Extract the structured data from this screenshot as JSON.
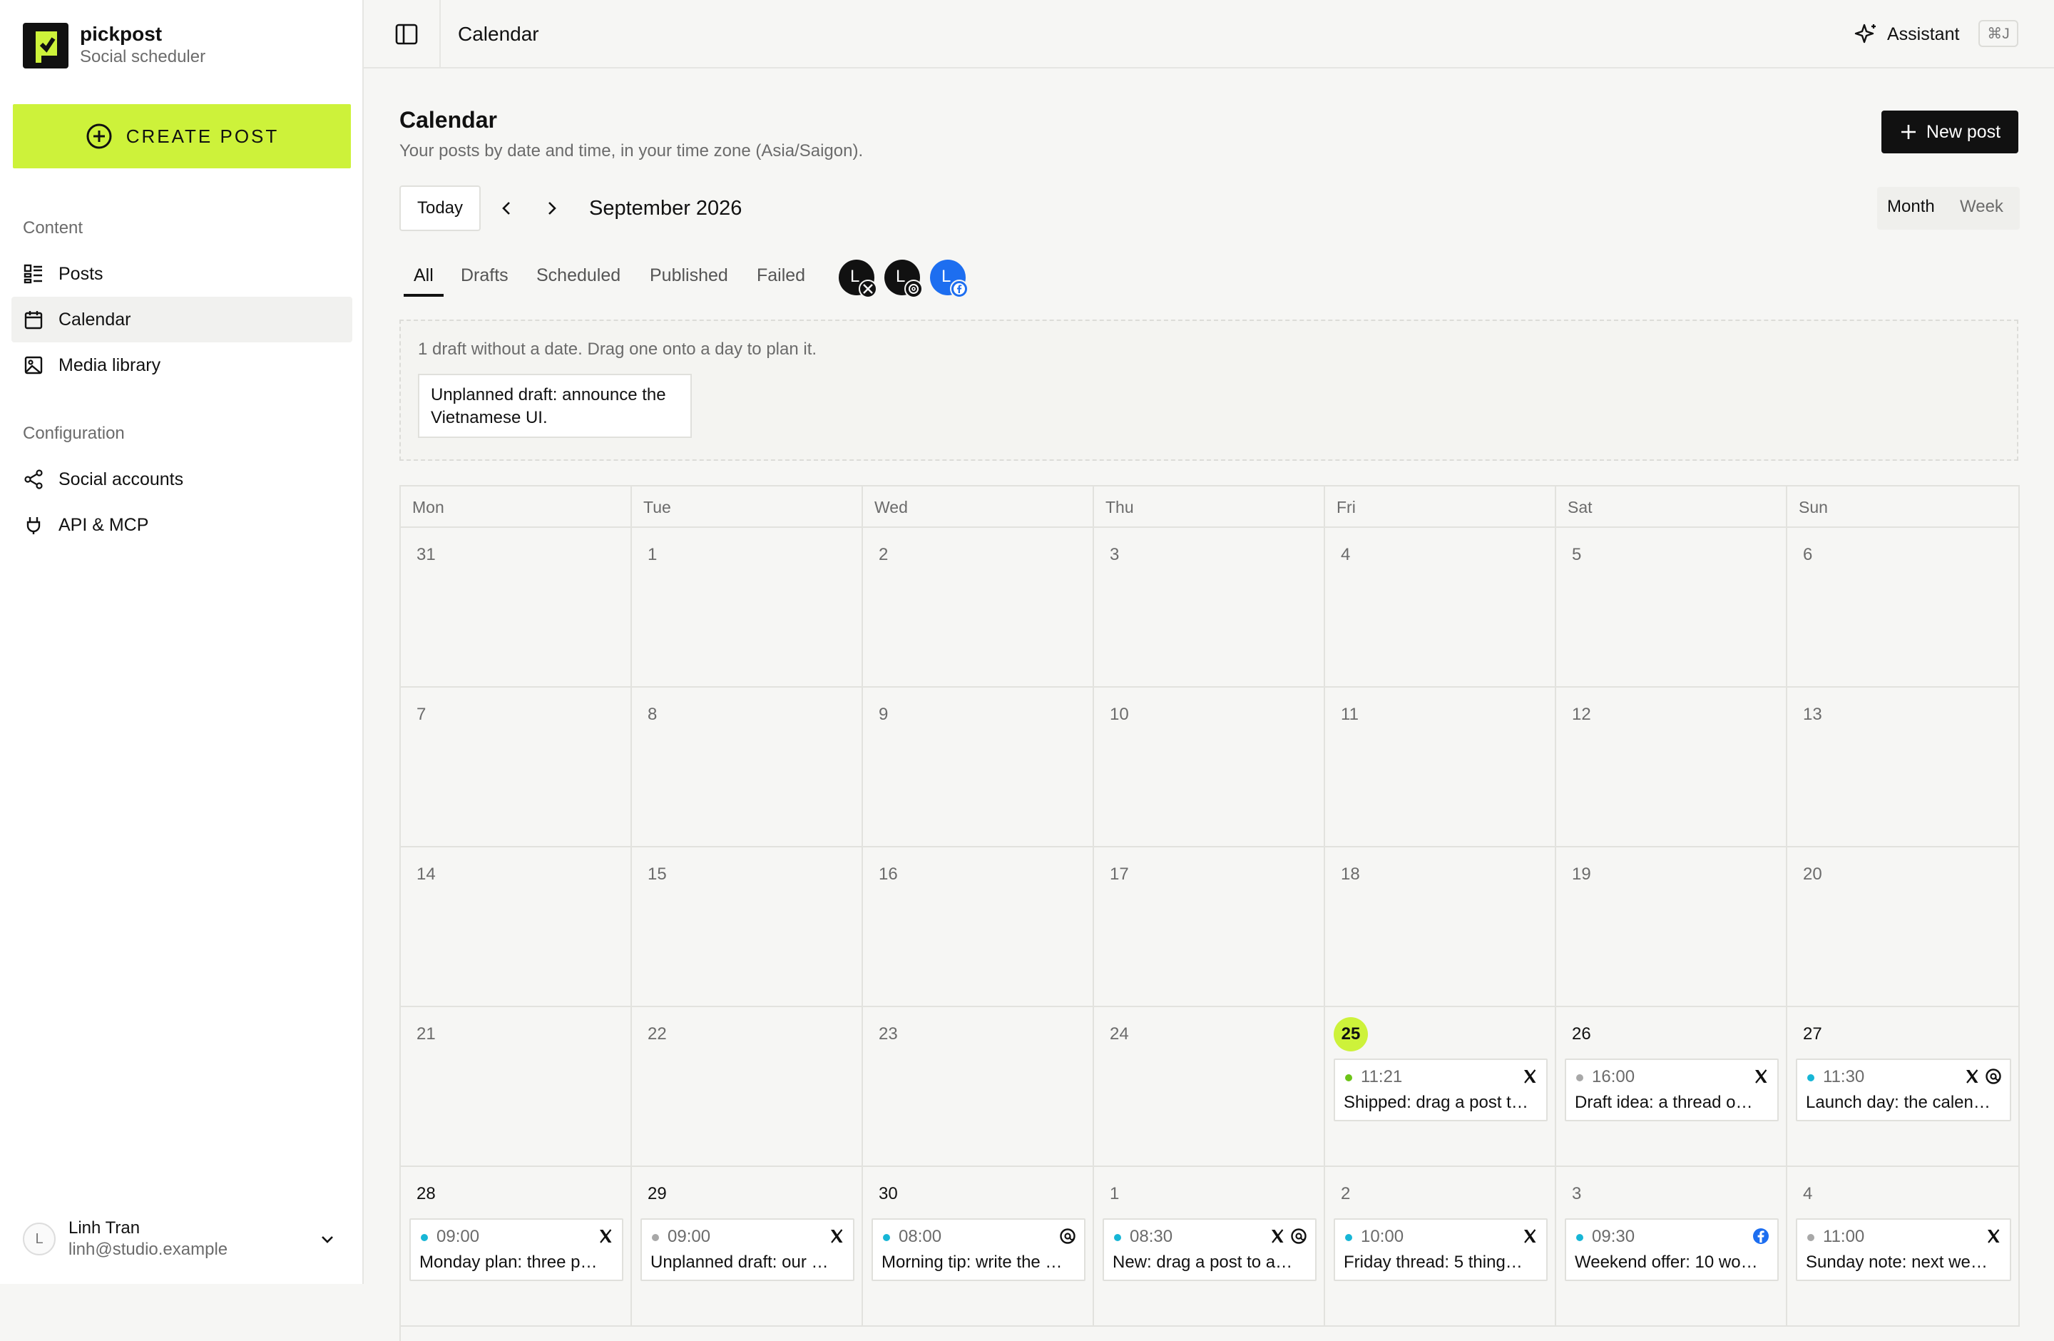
{
  "sidebar": {
    "brand": {
      "name": "pickpost",
      "subtitle": "Social scheduler"
    },
    "create_label": "CREATE POST",
    "sections": [
      {
        "label": "Content",
        "items": [
          {
            "label": "Posts",
            "icon": "posts-icon"
          },
          {
            "label": "Calendar",
            "icon": "calendar-icon",
            "active": true
          },
          {
            "label": "Media library",
            "icon": "image-icon"
          }
        ]
      },
      {
        "label": "Configuration",
        "items": [
          {
            "label": "Social accounts",
            "icon": "share-icon"
          },
          {
            "label": "API & MCP",
            "icon": "plug-icon"
          }
        ]
      }
    ],
    "user": {
      "initial": "L",
      "name": "Linh Tran",
      "email": "linh@studio.example"
    }
  },
  "topbar": {
    "title": "Calendar",
    "assistant_label": "Assistant",
    "shortcut": "⌘J"
  },
  "header": {
    "title": "Calendar",
    "subtitle": "Your posts by date and time, in your time zone (Asia/Saigon).",
    "new_post_label": "New post"
  },
  "toolbar": {
    "today_label": "Today",
    "month_label": "September 2026",
    "views": [
      "Month",
      "Week"
    ],
    "active_view": "Month"
  },
  "filters": {
    "tabs": [
      "All",
      "Drafts",
      "Scheduled",
      "Published",
      "Failed"
    ],
    "active": "All"
  },
  "accounts": [
    {
      "initial": "L",
      "network": "x"
    },
    {
      "initial": "L",
      "network": "threads"
    },
    {
      "initial": "L",
      "network": "facebook"
    }
  ],
  "unplanned": {
    "message": "1 draft without a date. Drag one onto a day to plan it.",
    "drafts": [
      "Unplanned draft: announce the Vietnamese UI."
    ]
  },
  "calendar": {
    "weekdays": [
      "Mon",
      "Tue",
      "Wed",
      "Thu",
      "Fri",
      "Sat",
      "Sun"
    ],
    "today": "25",
    "weeks": [
      [
        {
          "d": "31"
        },
        {
          "d": "1"
        },
        {
          "d": "2"
        },
        {
          "d": "3"
        },
        {
          "d": "4"
        },
        {
          "d": "5"
        },
        {
          "d": "6"
        }
      ],
      [
        {
          "d": "7"
        },
        {
          "d": "8"
        },
        {
          "d": "9"
        },
        {
          "d": "10"
        },
        {
          "d": "11"
        },
        {
          "d": "12"
        },
        {
          "d": "13"
        }
      ],
      [
        {
          "d": "14"
        },
        {
          "d": "15"
        },
        {
          "d": "16"
        },
        {
          "d": "17"
        },
        {
          "d": "18"
        },
        {
          "d": "19"
        },
        {
          "d": "20"
        }
      ],
      [
        {
          "d": "21"
        },
        {
          "d": "22"
        },
        {
          "d": "23"
        },
        {
          "d": "24"
        },
        {
          "d": "25",
          "today": true,
          "cur": true,
          "posts": [
            {
              "time": "11:21",
              "text": "Shipped: drag a post t…",
              "status": "published",
              "nets": [
                "x"
              ]
            }
          ]
        },
        {
          "d": "26",
          "cur": true,
          "posts": [
            {
              "time": "16:00",
              "text": "Draft idea: a thread o…",
              "status": "draft",
              "nets": [
                "x"
              ]
            }
          ]
        },
        {
          "d": "27",
          "cur": true,
          "posts": [
            {
              "time": "11:30",
              "text": "Launch day: the calen…",
              "status": "scheduled",
              "nets": [
                "x",
                "threads"
              ]
            }
          ]
        }
      ],
      [
        {
          "d": "28",
          "cur": true,
          "posts": [
            {
              "time": "09:00",
              "text": "Monday plan: three p…",
              "status": "scheduled",
              "nets": [
                "x"
              ]
            }
          ]
        },
        {
          "d": "29",
          "cur": true,
          "posts": [
            {
              "time": "09:00",
              "text": "Unplanned draft: our …",
              "status": "draft",
              "nets": [
                "x"
              ]
            }
          ]
        },
        {
          "d": "30",
          "cur": true,
          "posts": [
            {
              "time": "08:00",
              "text": "Morning tip: write the …",
              "status": "scheduled",
              "nets": [
                "threads"
              ]
            }
          ]
        },
        {
          "d": "1",
          "posts": [
            {
              "time": "08:30",
              "text": "New: drag a post to a…",
              "status": "scheduled",
              "nets": [
                "x",
                "threads"
              ]
            }
          ]
        },
        {
          "d": "2",
          "posts": [
            {
              "time": "10:00",
              "text": "Friday thread: 5 thing…",
              "status": "scheduled",
              "nets": [
                "x"
              ]
            }
          ]
        },
        {
          "d": "3",
          "posts": [
            {
              "time": "09:30",
              "text": "Weekend offer: 10 wo…",
              "status": "scheduled",
              "nets": [
                "facebook"
              ]
            }
          ]
        },
        {
          "d": "4",
          "posts": [
            {
              "time": "11:00",
              "text": "Sunday note: next we…",
              "status": "draft",
              "nets": [
                "x"
              ]
            }
          ]
        }
      ]
    ]
  },
  "colors": {
    "accent": "#cdf23a",
    "dark": "#111111",
    "published": "#6cc417",
    "scheduled": "#17b6d6",
    "draft": "#a8a8a8",
    "facebook": "#1d6ef0"
  }
}
